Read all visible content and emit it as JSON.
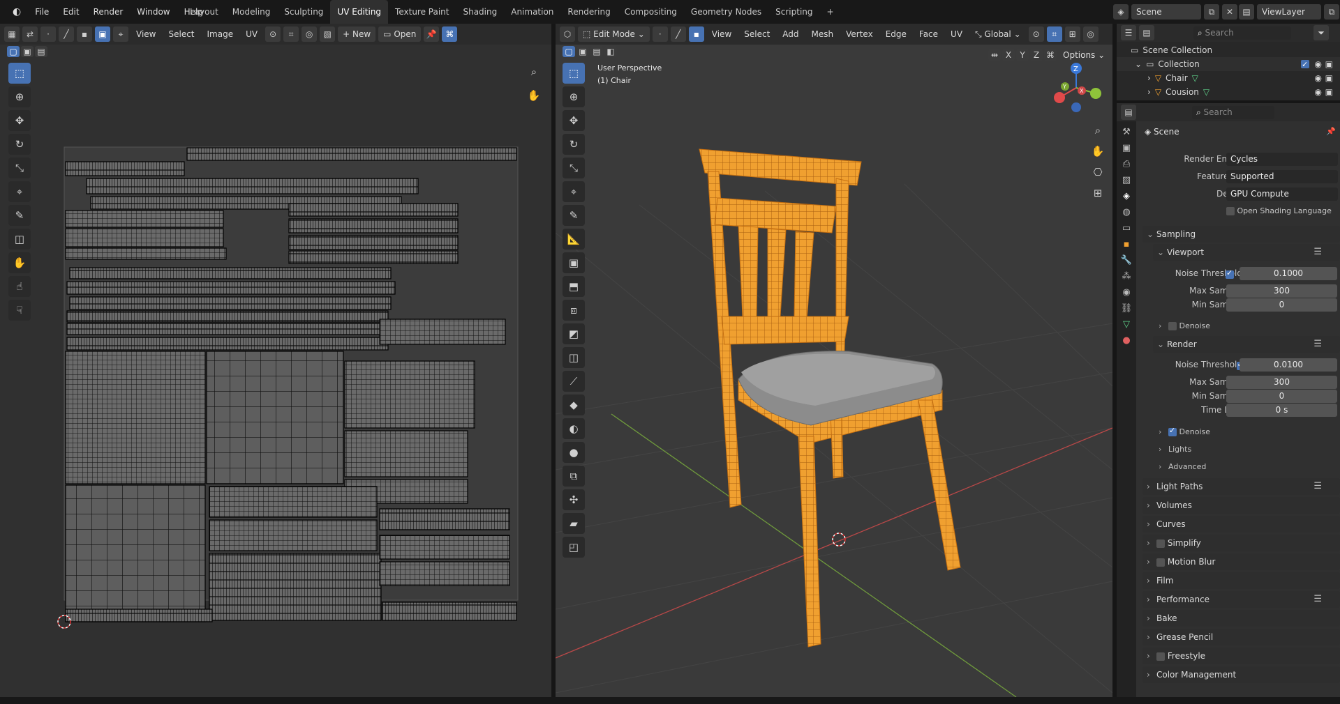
{
  "menu": [
    "File",
    "Edit",
    "Render",
    "Window",
    "Help"
  ],
  "workspaces": [
    "Layout",
    "Modeling",
    "Sculpting",
    "UV Editing",
    "Texture Paint",
    "Shading",
    "Animation",
    "Rendering",
    "Compositing",
    "Geometry Nodes",
    "Scripting"
  ],
  "active_workspace": "UV Editing",
  "scene_name": "Scene",
  "view_layer": "ViewLayer",
  "uv_header": {
    "menus": [
      "View",
      "Select",
      "Image",
      "UV"
    ],
    "new_label": "New",
    "open_label": "Open"
  },
  "viewport_header": {
    "mode": "Edit Mode",
    "menus": [
      "View",
      "Select",
      "Add",
      "Mesh",
      "Vertex",
      "Edge",
      "Face",
      "UV"
    ],
    "transform_orientation": "Global",
    "options_label": "Options",
    "axes": [
      "X",
      "Y",
      "Z"
    ]
  },
  "viewport_overlay": {
    "view_name": "User Perspective",
    "object_name": "(1) Chair"
  },
  "outliner": {
    "search_placeholder": "Search",
    "root": "Scene Collection",
    "collection": "Collection",
    "objects": [
      "Chair",
      "Cousion"
    ]
  },
  "properties": {
    "search_placeholder": "Search",
    "context": "Scene",
    "render_engine_label": "Render Engine",
    "render_engine": "Cycles",
    "feature_set_label": "Feature Set",
    "feature_set": "Supported",
    "device_label": "Device",
    "device": "GPU Compute",
    "osl_label": "Open Shading Language",
    "sampling": "Sampling",
    "viewport": "Viewport",
    "noise_threshold_label": "Noise Threshold",
    "viewport_noise": "0.1000",
    "max_samples_label": "Max Samples",
    "viewport_max": "300",
    "min_samples_label": "Min Samples",
    "viewport_min": "0",
    "denoise_label": "Denoise",
    "render": "Render",
    "render_noise": "0.0100",
    "render_max": "300",
    "render_min": "0",
    "time_limit_label": "Time Limit",
    "time_limit": "0 s",
    "lights": "Lights",
    "advanced": "Advanced",
    "sections": [
      "Light Paths",
      "Volumes",
      "Curves",
      "Simplify",
      "Motion Blur",
      "Film",
      "Performance",
      "Bake",
      "Grease Pencil",
      "Freestyle",
      "Color Management"
    ]
  },
  "colors": {
    "accent": "#4772b3",
    "selection": "#f5a623",
    "wire": "#e8901a"
  }
}
